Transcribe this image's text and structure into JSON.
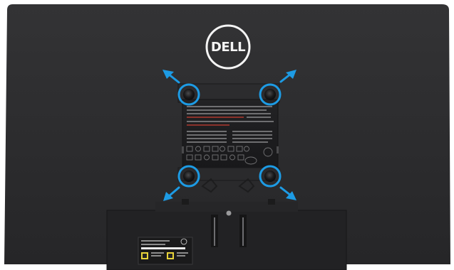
{
  "logo": {
    "text": "DELL",
    "icon": "dell-logo-icon"
  },
  "callouts": {
    "circle_color": "#1d9be4",
    "arrow_color": "#1d9be4",
    "circles": [
      {
        "name": "vesa-screw-top-left",
        "icon": "circle-highlight-icon"
      },
      {
        "name": "vesa-screw-top-right",
        "icon": "circle-highlight-icon"
      },
      {
        "name": "vesa-screw-bottom-left",
        "icon": "circle-highlight-icon"
      },
      {
        "name": "vesa-screw-bottom-right",
        "icon": "circle-highlight-icon"
      }
    ],
    "arrows": [
      {
        "name": "arrow-up-left-icon"
      },
      {
        "name": "arrow-up-right-icon"
      },
      {
        "name": "arrow-down-left-icon"
      },
      {
        "name": "arrow-down-right-icon"
      }
    ]
  },
  "colors": {
    "monitor_back": "#2a2a2c",
    "label_plate": "#1b1b1c",
    "stand_mount": "#222224"
  }
}
